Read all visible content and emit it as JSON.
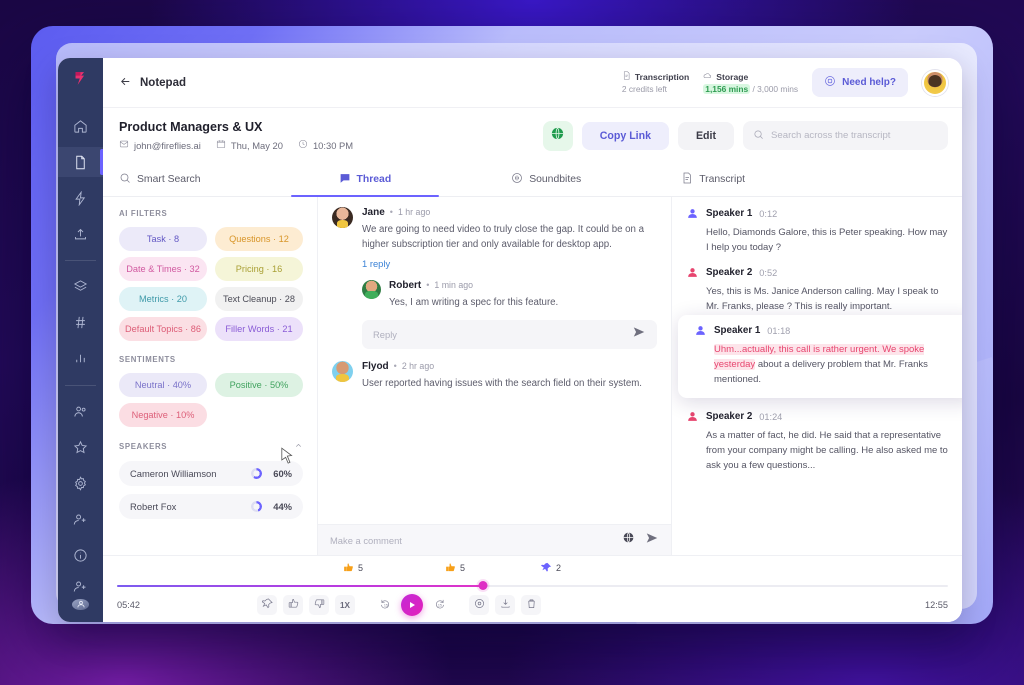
{
  "rail": {
    "logo": "fireflies-logo-icon",
    "items": [
      {
        "name": "home",
        "icon": "home-icon"
      },
      {
        "name": "notepad",
        "icon": "document-icon",
        "active": true
      },
      {
        "name": "automation",
        "icon": "lightning-icon"
      },
      {
        "name": "upload",
        "icon": "upload-icon"
      },
      {
        "name": "channels",
        "icon": "layers-icon"
      },
      {
        "name": "topics",
        "icon": "hash-icon"
      },
      {
        "name": "analytics",
        "icon": "bar-chart-icon"
      },
      {
        "name": "teams",
        "icon": "users-icon"
      },
      {
        "name": "favorites",
        "icon": "star-icon"
      },
      {
        "name": "settings",
        "icon": "gear-icon"
      },
      {
        "name": "invite",
        "icon": "add-user-icon"
      },
      {
        "name": "info",
        "icon": "info-icon"
      }
    ],
    "bottom": [
      {
        "name": "invite-member",
        "icon": "add-user-icon"
      },
      {
        "name": "account-avatar",
        "icon": "avatar-icon"
      }
    ]
  },
  "topbar": {
    "back_label": "Notepad",
    "transcription": {
      "label": "Transcription",
      "value": "2 credits left"
    },
    "storage": {
      "label": "Storage",
      "used": "1,156 mins",
      "separator": " / ",
      "total": "3,000 mins"
    },
    "need_help": "Need help?"
  },
  "title": {
    "heading": "Product Managers & UX",
    "email": "john@fireflies.ai",
    "date": "Thu, May 20",
    "time": "10:30 PM",
    "copy_link": "Copy Link",
    "edit": "Edit"
  },
  "search": {
    "placeholder": "Search across the transcript",
    "value": ""
  },
  "tabs": [
    {
      "label": "Smart Search",
      "icon": "search-icon",
      "active": false
    },
    {
      "label": "Thread",
      "icon": "chat-icon",
      "active": true
    },
    {
      "label": "Soundbites",
      "icon": "soundwave-icon",
      "active": false
    },
    {
      "label": "Transcript",
      "icon": "document-icon",
      "active": false
    }
  ],
  "filters": {
    "ai_title": "AI FILTERS",
    "chips": [
      {
        "label": "Task · 8",
        "bg": "#eceaf9",
        "fg": "#6257c4"
      },
      {
        "label": "Questions · 12",
        "bg": "#fdecd2",
        "fg": "#d89528"
      },
      {
        "label": "Date & Times · 32",
        "bg": "#fbe5f2",
        "fg": "#d159a0"
      },
      {
        "label": "Pricing · 16",
        "bg": "#f5f5d8",
        "fg": "#a9a035"
      },
      {
        "label": "Metrics · 20",
        "bg": "#dff3f6",
        "fg": "#3f9aa9"
      },
      {
        "label": "Text Cleanup · 28",
        "bg": "#f1f1f1",
        "fg": "#4d4d58"
      },
      {
        "label": "Default Topics · 86",
        "bg": "#fbdfe4",
        "fg": "#dd5d77"
      },
      {
        "label": "Filler Words · 21",
        "bg": "#ece1fa",
        "fg": "#8a5cd6"
      }
    ],
    "sentiments_title": "SENTIMENTS",
    "sentiments": [
      {
        "label": "Neutral · 40%",
        "bg": "#ebe9f8",
        "fg": "#7a72c9"
      },
      {
        "label": "Positive · 50%",
        "bg": "#ddf2e3",
        "fg": "#41a35f"
      },
      {
        "label": "Negative · 10%",
        "bg": "#fbdde3",
        "fg": "#dd5f79"
      }
    ],
    "speakers_title": "SPEAKERS",
    "speakers": [
      {
        "name": "Cameron Williamson",
        "percent": "60%",
        "value": 60
      },
      {
        "name": "Robert Fox",
        "percent": "44%",
        "value": 44
      }
    ]
  },
  "thread": {
    "posts": [
      {
        "author": "Jane",
        "time": "1 hr ago",
        "text": "We are going to need video to truly close the gap. It could be on a higher subscription tier and only available for desktop app.",
        "reply_link": "1 reply",
        "reply": {
          "author": "Robert",
          "time": "1 min ago",
          "text": "Yes, I am writing a spec for this feature."
        }
      },
      {
        "author": "Flyod",
        "time": "2 hr ago",
        "text": "User reported having issues with the search field on their system."
      }
    ],
    "reply_placeholder": "Reply",
    "comment_placeholder": "Make a comment"
  },
  "transcript": {
    "lines": [
      {
        "speaker": "Speaker 1",
        "time": "0:12",
        "color": "#6c63ff",
        "text": "Hello, Diamonds Galore, this is Peter speaking. How may I help you today ?"
      },
      {
        "speaker": "Speaker 2",
        "time": "0:52",
        "color": "#e7456f",
        "text": "Yes, this is Ms. Janice Anderson calling. May I speak to Mr. Franks, please ? This is really important."
      },
      {
        "speaker": "Speaker 1",
        "time": "01:18",
        "color": "#6c63ff",
        "highlighted_text": "Uhm...actually, this call is rather urgent. We spoke yesterday",
        "text": "about a delivery problem that Mr. Franks mentioned.",
        "highlight": true
      },
      {
        "speaker": "Speaker 2",
        "time": "01:24",
        "color": "#e7456f",
        "text": "As a matter of fact, he did. He said that a representative from your company might be calling. He also asked me to ask you a few questions..."
      }
    ]
  },
  "player": {
    "reactions": [
      {
        "icon": "thumbs-up-icon",
        "count": "5"
      },
      {
        "icon": "thumbs-up-icon",
        "count": "5"
      },
      {
        "icon": "pin-icon",
        "count": "2"
      }
    ],
    "current_time": "05:42",
    "duration": "12:55",
    "progress_percent": 44,
    "speed": "1X",
    "controls": [
      {
        "name": "pin",
        "icon": "pin-icon"
      },
      {
        "name": "like",
        "icon": "thumbs-up-icon"
      },
      {
        "name": "dislike",
        "icon": "thumbs-down-icon"
      },
      {
        "name": "rewind-15",
        "icon": "rewind-15-icon"
      },
      {
        "name": "play",
        "icon": "play-icon"
      },
      {
        "name": "forward-15",
        "icon": "forward-15-icon"
      },
      {
        "name": "settings",
        "icon": "gear-icon"
      },
      {
        "name": "download",
        "icon": "download-icon"
      },
      {
        "name": "delete",
        "icon": "trash-icon"
      }
    ]
  },
  "colors": {
    "accent": "#6c63ff",
    "brand_pink": "#e7456f",
    "magenta": "#de2ec4",
    "rail_bg": "#2f3a63"
  }
}
